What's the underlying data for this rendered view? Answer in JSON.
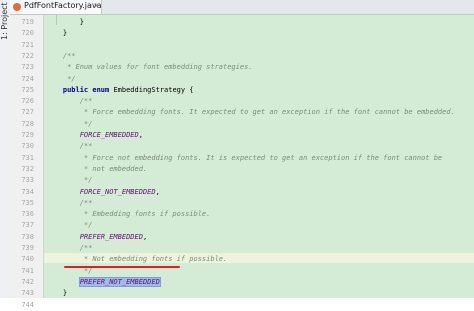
{
  "sidebar": {
    "label": "1: Project"
  },
  "tab": {
    "label": "PdfFontFactory.java",
    "close": "×"
  },
  "lines": [
    {
      "n": "719",
      "parts": [
        {
          "t": "        }",
          "c": "plain"
        }
      ]
    },
    {
      "n": "720",
      "parts": [
        {
          "t": "    }",
          "c": "plain"
        }
      ]
    },
    {
      "n": "721",
      "parts": []
    },
    {
      "n": "722",
      "parts": [
        {
          "t": "    /**",
          "c": "comment"
        }
      ]
    },
    {
      "n": "723",
      "parts": [
        {
          "t": "     * Enum values for font embedding strategies.",
          "c": "comment"
        }
      ]
    },
    {
      "n": "724",
      "parts": [
        {
          "t": "     */",
          "c": "comment"
        }
      ]
    },
    {
      "n": "725",
      "parts": [
        {
          "t": "    public enum ",
          "c": "kw"
        },
        {
          "t": "EmbeddingStrategy {",
          "c": "plain"
        }
      ]
    },
    {
      "n": "726",
      "parts": [
        {
          "t": "        /**",
          "c": "comment"
        }
      ]
    },
    {
      "n": "727",
      "parts": [
        {
          "t": "         * Force embedding fonts. It expected to get an exception if the font cannot be embedded.",
          "c": "comment"
        }
      ]
    },
    {
      "n": "728",
      "parts": [
        {
          "t": "         */",
          "c": "comment"
        }
      ]
    },
    {
      "n": "729",
      "parts": [
        {
          "t": "        FORCE_EMBEDDED",
          "c": "field"
        },
        {
          "t": ",",
          "c": "plain"
        }
      ]
    },
    {
      "n": "730",
      "parts": [
        {
          "t": "        /**",
          "c": "comment"
        }
      ]
    },
    {
      "n": "731",
      "parts": [
        {
          "t": "         * Force not embedding fonts. It is expected to get an exception if the font cannot be",
          "c": "comment"
        }
      ]
    },
    {
      "n": "732",
      "parts": [
        {
          "t": "         * not embedded.",
          "c": "comment"
        }
      ]
    },
    {
      "n": "733",
      "parts": [
        {
          "t": "         */",
          "c": "comment"
        }
      ]
    },
    {
      "n": "734",
      "parts": [
        {
          "t": "        FORCE_NOT_EMBEDDED",
          "c": "field"
        },
        {
          "t": ",",
          "c": "plain"
        }
      ]
    },
    {
      "n": "735",
      "parts": [
        {
          "t": "        /**",
          "c": "comment"
        }
      ]
    },
    {
      "n": "736",
      "parts": [
        {
          "t": "         * Embedding fonts if possible.",
          "c": "comment"
        }
      ]
    },
    {
      "n": "737",
      "parts": [
        {
          "t": "         */",
          "c": "comment"
        }
      ]
    },
    {
      "n": "738",
      "parts": [
        {
          "t": "        PREFER_EMBEDDED",
          "c": "field"
        },
        {
          "t": ",",
          "c": "plain"
        }
      ]
    },
    {
      "n": "739",
      "parts": [
        {
          "t": "        /**",
          "c": "comment"
        }
      ]
    },
    {
      "n": "740",
      "parts": [
        {
          "t": "         * Not embedding fonts if possible.",
          "c": "comment"
        }
      ]
    },
    {
      "n": "741",
      "parts": [
        {
          "t": "         */",
          "c": "comment"
        }
      ]
    },
    {
      "n": "742",
      "parts": [
        {
          "t": "        ",
          "c": "plain"
        },
        {
          "t": "PREFER_NOT_EMBEDDED",
          "c": "sel"
        }
      ]
    },
    {
      "n": "743",
      "parts": [
        {
          "t": "    }",
          "c": "plain"
        }
      ]
    },
    {
      "n": "744",
      "parts": []
    }
  ],
  "highlight": {
    "color": "#e02020",
    "annotated_line": "742"
  }
}
